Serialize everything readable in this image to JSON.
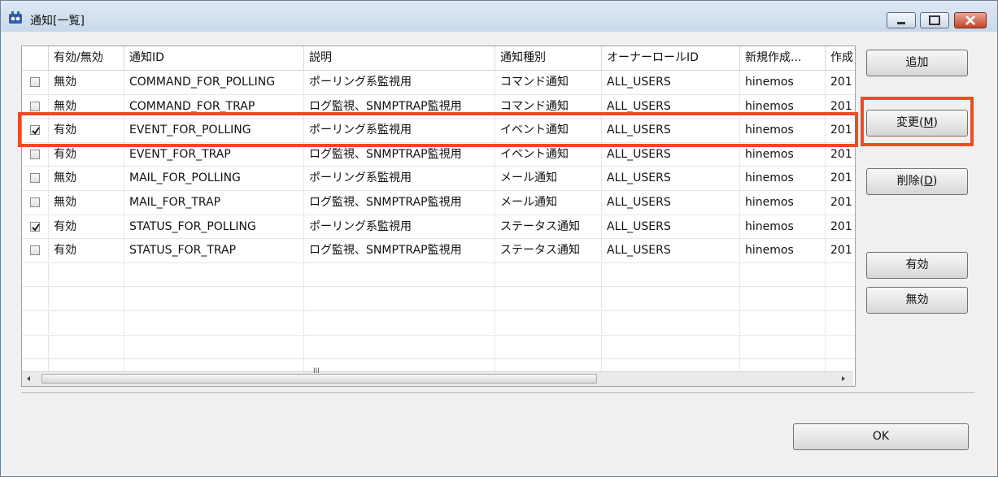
{
  "window": {
    "title": "通知[一覧]"
  },
  "table": {
    "headers": [
      "",
      "有効/無効",
      "通知ID",
      "説明",
      "通知種別",
      "オーナーロールID",
      "新規作成...",
      "作成"
    ],
    "rows": [
      {
        "checked": false,
        "status": "無効",
        "id": "COMMAND_FOR_POLLING",
        "desc": "ポーリング系監視用",
        "type": "コマンド通知",
        "owner": "ALL_USERS",
        "creator": "hinemos",
        "created": "201"
      },
      {
        "checked": false,
        "status": "無効",
        "id": "COMMAND_FOR_TRAP",
        "desc": "ログ監視、SNMPTRAP監視用",
        "type": "コマンド通知",
        "owner": "ALL_USERS",
        "creator": "hinemos",
        "created": "201"
      },
      {
        "checked": true,
        "status": "有効",
        "id": "EVENT_FOR_POLLING",
        "desc": "ポーリング系監視用",
        "type": "イベント通知",
        "owner": "ALL_USERS",
        "creator": "hinemos",
        "created": "201"
      },
      {
        "checked": false,
        "status": "有効",
        "id": "EVENT_FOR_TRAP",
        "desc": "ログ監視、SNMPTRAP監視用",
        "type": "イベント通知",
        "owner": "ALL_USERS",
        "creator": "hinemos",
        "created": "201"
      },
      {
        "checked": false,
        "status": "無効",
        "id": "MAIL_FOR_POLLING",
        "desc": "ポーリング系監視用",
        "type": "メール通知",
        "owner": "ALL_USERS",
        "creator": "hinemos",
        "created": "201"
      },
      {
        "checked": false,
        "status": "無効",
        "id": "MAIL_FOR_TRAP",
        "desc": "ログ監視、SNMPTRAP監視用",
        "type": "メール通知",
        "owner": "ALL_USERS",
        "creator": "hinemos",
        "created": "201"
      },
      {
        "checked": true,
        "status": "有効",
        "id": "STATUS_FOR_POLLING",
        "desc": "ポーリング系監視用",
        "type": "ステータス通知",
        "owner": "ALL_USERS",
        "creator": "hinemos",
        "created": "201"
      },
      {
        "checked": false,
        "status": "有効",
        "id": "STATUS_FOR_TRAP",
        "desc": "ログ監視、SNMPTRAP監視用",
        "type": "ステータス通知",
        "owner": "ALL_USERS",
        "creator": "hinemos",
        "created": "201"
      }
    ],
    "empty_rows": 5
  },
  "buttons": {
    "add": "追加",
    "modify": "変更(",
    "modify_key": "M",
    "modify_end": ")",
    "delete": "削除(",
    "delete_key": "D",
    "delete_end": ")",
    "enable": "有効",
    "disable": "無効",
    "ok": "OK"
  },
  "scrollbar": {
    "grip": "III"
  },
  "colors": {
    "highlight": "#f04a22"
  }
}
